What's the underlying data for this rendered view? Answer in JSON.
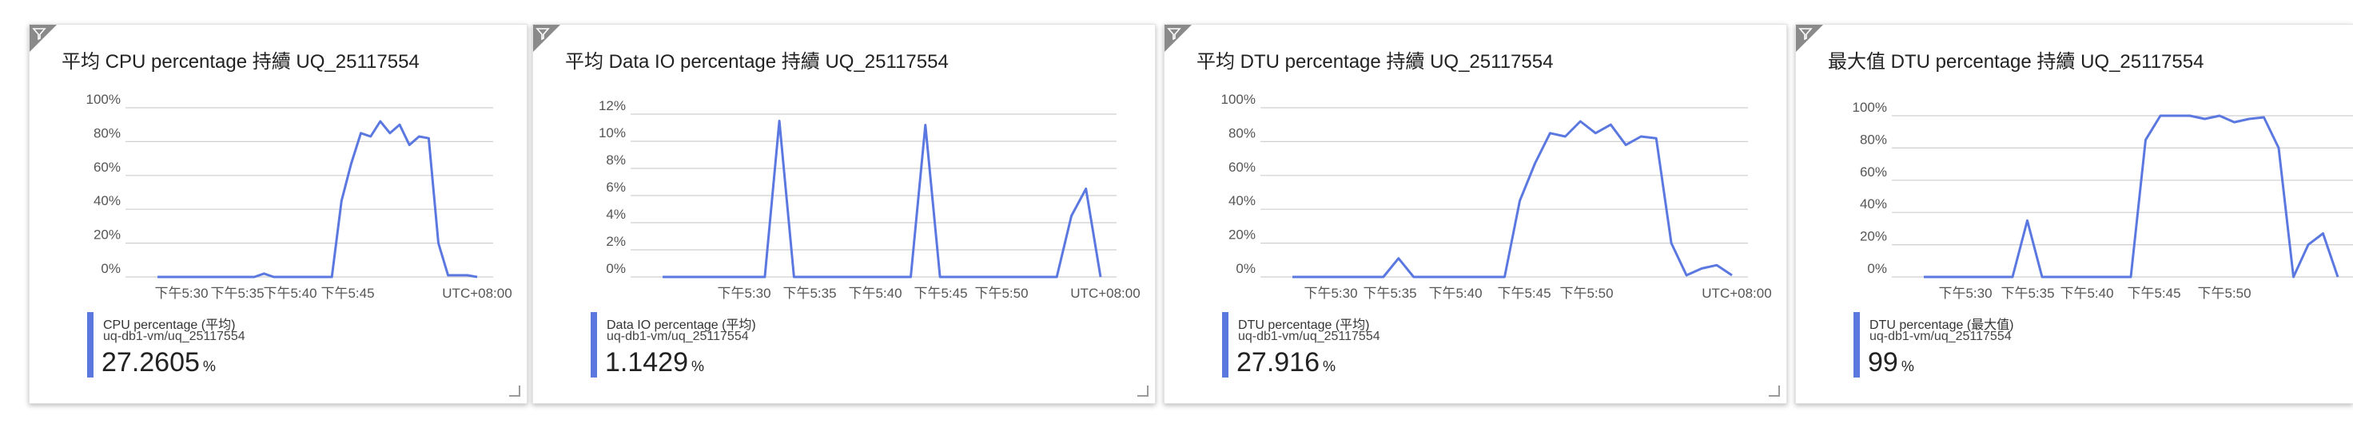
{
  "colors": {
    "series": "#5b78e0",
    "grid": "#cfcfcf",
    "axis_text": "#555555"
  },
  "tiles": [
    {
      "title": "平均 CPU percentage 持續 UQ_25117554",
      "legend": {
        "name": "CPU percentage (平均)",
        "resource": "uq-db1-vm/uq_25117554",
        "value": "27.2605",
        "unit": "%"
      },
      "chart_data": {
        "type": "line",
        "title": "平均 CPU percentage 持續 UQ_25117554",
        "y_ticks": [
          "100%",
          "80%",
          "60%",
          "40%",
          "20%",
          "0%"
        ],
        "ylim": [
          0,
          100
        ],
        "x_ticks": [
          "下午5:30",
          "下午5:35",
          "下午5:40",
          "下午5:45"
        ],
        "timezone": "UTC+08:00",
        "series": [
          {
            "name": "CPU percentage (平均)",
            "values": [
              0,
              0,
              0,
              0,
              0,
              0,
              0,
              0,
              0,
              0,
              0,
              2,
              0,
              0,
              0,
              0,
              0,
              0,
              0,
              45,
              67,
              85,
              83,
              92,
              85,
              90,
              78,
              83,
              82,
              20,
              1,
              1,
              1,
              0
            ]
          }
        ]
      }
    },
    {
      "title": "平均 Data IO percentage 持續 UQ_25117554",
      "legend": {
        "name": "Data IO percentage (平均)",
        "resource": "uq-db1-vm/uq_25117554",
        "value": "1.1429",
        "unit": "%"
      },
      "chart_data": {
        "type": "line",
        "title": "平均 Data IO percentage 持續 UQ_25117554",
        "y_ticks": [
          "12%",
          "10%",
          "8%",
          "6%",
          "4%",
          "2%",
          "0%"
        ],
        "ylim": [
          0,
          12
        ],
        "x_ticks": [
          "下午5:30",
          "下午5:35",
          "下午5:40",
          "下午5:45",
          "下午5:50"
        ],
        "timezone": "UTC+08:00",
        "series": [
          {
            "name": "Data IO percentage (平均)",
            "values": [
              0,
              0,
              0,
              0,
              0,
              0,
              0,
              0,
              11.5,
              0,
              0,
              0,
              0,
              0,
              0,
              0,
              0,
              0,
              11.2,
              0,
              0,
              0,
              0,
              0,
              0,
              0,
              0,
              0,
              4.5,
              6.5,
              0
            ]
          }
        ]
      }
    },
    {
      "title": "平均 DTU percentage 持續 UQ_25117554",
      "legend": {
        "name": "DTU percentage (平均)",
        "resource": "uq-db1-vm/uq_25117554",
        "value": "27.916",
        "unit": "%"
      },
      "chart_data": {
        "type": "line",
        "title": "平均 DTU percentage 持續 UQ_25117554",
        "y_ticks": [
          "100%",
          "80%",
          "60%",
          "40%",
          "20%",
          "0%"
        ],
        "ylim": [
          0,
          100
        ],
        "x_ticks": [
          "下午5:30",
          "下午5:35",
          "下午5:40",
          "下午5:45",
          "下午5:50"
        ],
        "timezone": "UTC+08:00",
        "series": [
          {
            "name": "DTU percentage (平均)",
            "values": [
              0,
              0,
              0,
              0,
              0,
              0,
              0,
              11,
              0,
              0,
              0,
              0,
              0,
              0,
              0,
              45,
              67,
              85,
              83,
              92,
              85,
              90,
              78,
              83,
              82,
              20,
              1,
              5,
              7,
              1
            ]
          }
        ]
      }
    },
    {
      "title": "最大值 DTU percentage 持續 UQ_25117554",
      "legend": {
        "name": "DTU percentage (最大值)",
        "resource": "uq-db1-vm/uq_25117554",
        "value": "99",
        "unit": "%"
      },
      "chart_data": {
        "type": "line",
        "title": "最大值 DTU percentage 持續 UQ_25117554",
        "y_ticks": [
          "100%",
          "80%",
          "60%",
          "40%",
          "20%",
          "0%"
        ],
        "ylim": [
          0,
          100
        ],
        "x_ticks": [
          "下午5:30",
          "下午5:35",
          "下午5:40",
          "下午5:45",
          "下午5:50"
        ],
        "timezone": "",
        "series": [
          {
            "name": "DTU percentage (最大值)",
            "values": [
              0,
              0,
              0,
              0,
              0,
              0,
              0,
              35,
              0,
              0,
              0,
              0,
              0,
              0,
              0,
              85,
              100,
              100,
              100,
              98,
              100,
              96,
              98,
              99,
              80,
              0,
              20,
              27,
              0
            ]
          }
        ]
      }
    }
  ]
}
